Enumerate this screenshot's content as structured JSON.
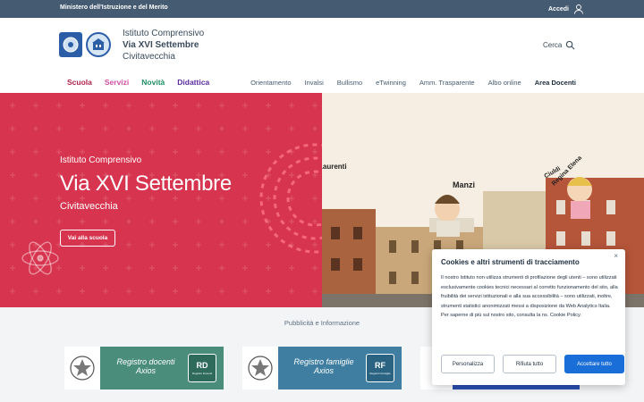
{
  "topbar": {
    "ministry": "Ministero dell'Istruzione e del Merito",
    "login": "Accedi",
    "login_icon": "user-icon"
  },
  "header": {
    "name_line1": "Istituto Comprensivo",
    "name_line2": "Via XVI Settembre",
    "name_line3": "Civitavecchia",
    "search_label": "Cerca",
    "search_icon": "search-icon"
  },
  "nav": {
    "main": [
      {
        "label": "Scuola",
        "color": "#b0234a"
      },
      {
        "label": "Servizi",
        "color": "#d14fa4"
      },
      {
        "label": "Novità",
        "color": "#1f8d64"
      },
      {
        "label": "Didattica",
        "color": "#5a2aa0"
      }
    ],
    "secondary": [
      "Orientamento",
      "Invalsi",
      "Bullismo",
      "eTwinning",
      "Amm. Trasparente",
      "Albo online",
      "Area Docenti"
    ]
  },
  "hero": {
    "line1": "Istituto Comprensivo",
    "line2": "Via XVI Settembre",
    "line3": "Civitavecchia",
    "button": "Vai alla scuola",
    "bg_color": "#d7354f",
    "image_labels": {
      "a": "Laurenti",
      "b": "Manzi",
      "c": "Ciuldi",
      "d": "Regina Elena"
    }
  },
  "publicity": {
    "title": "Pubblicità e Informazione",
    "banners": [
      {
        "line1": "Registro docenti",
        "line2": "Axios",
        "badge": "RD",
        "badge_sub": "Registro Docenti",
        "color": "#4a8d7a"
      },
      {
        "line1": "Registro famiglie",
        "line2": "Axios",
        "badge": "RF",
        "badge_sub": "Registro Famiglie",
        "color": "#3f7ea0"
      }
    ]
  },
  "cookie": {
    "title": "Cookies e altri strumenti di tracciamento",
    "text": "Il nostro Istituto non utilizza strumenti di profilazione degli utenti – sono utilizzati esclusivamente cookies tecnici necessari al corretto funzionamento del sito, alla fruibilità dei servizi istituzionali e alla sua accessibilità – sono utilizzati, inoltre, strumenti statistici anonimizzati messi a disposizione da Web Analytics Italia.",
    "text2": "Per saperne di più sul nostro sito, consulta la ns. Cookie Policy.",
    "close": "×",
    "btn_customize": "Personalizza",
    "btn_reject": "Rifiuta tutto",
    "btn_accept": "Accettare tutto"
  }
}
